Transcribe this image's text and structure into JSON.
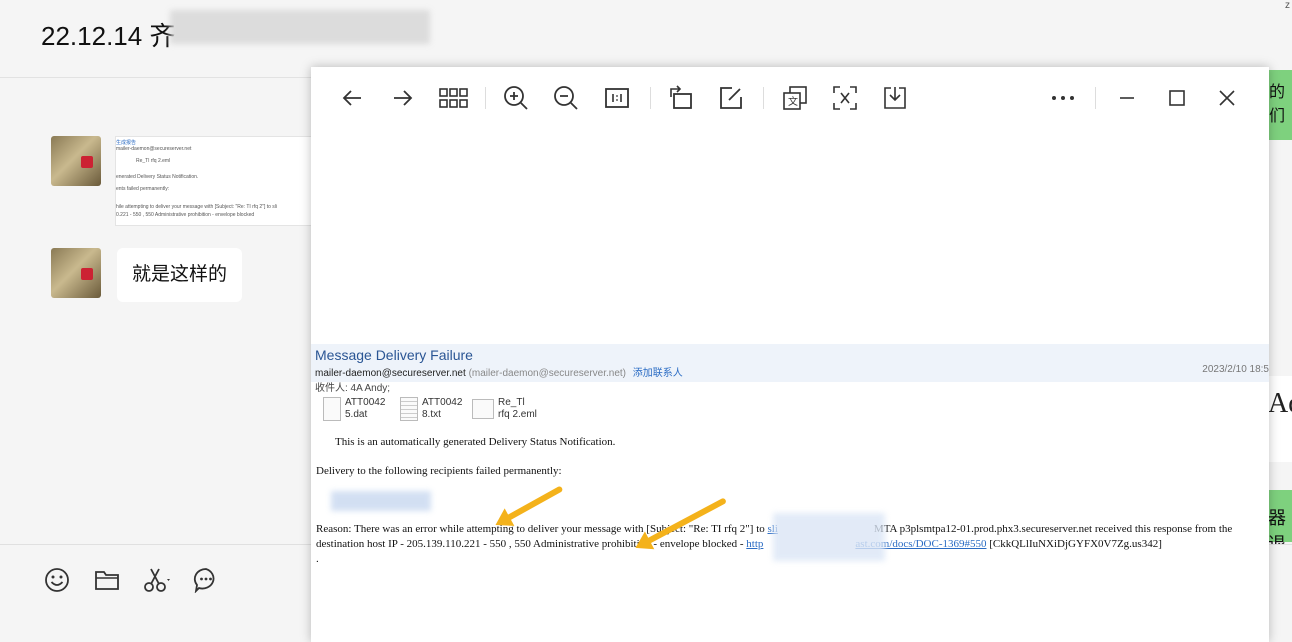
{
  "chat": {
    "title": "22.12.14 齐",
    "message_text": "就是这样的",
    "thumb_lines": [
      "生成报告",
      "mailer-daemon@secureserver.net",
      "Re_Tl rfq 2.eml",
      "enerated Delivery Status Notification.",
      "ents failed permanently:",
      "hile attempting to deliver your message with [Subject: \"Re: TI rfq 2\"] to sli",
      "0.221 - 550 , 550 Administrative prohibition - envelope blocked"
    ],
    "right_edge_texts": [
      "的们",
      "Ad",
      "器退"
    ]
  },
  "compose_icons": [
    "emoji-icon",
    "folder-icon",
    "scissors-icon",
    "chat-bubble-icon"
  ],
  "viewer": {
    "toolbar": [
      "back-icon",
      "forward-icon",
      "grid-icon",
      "zoom-in-icon",
      "zoom-out-icon",
      "actual-size-icon",
      "rotate-icon",
      "edit-icon",
      "translate-icon",
      "ocr-icon",
      "download-icon",
      "more-icon",
      "minimize-icon",
      "maximize-icon",
      "close-icon"
    ],
    "email": {
      "subject": "Message Delivery Failure",
      "from_address": "mailer-daemon@secureserver.net",
      "from_paren": "(mailer-daemon@secureserver.net)",
      "add_contact": "添加联系人",
      "date": "2023/2/10 18:5",
      "to": "收件人: 4A Andy;",
      "attachments": [
        {
          "line1": "ATT0042",
          "line2": "5.dat"
        },
        {
          "line1": "ATT0042",
          "line2": "8.txt"
        },
        {
          "line1": "Re_Tl",
          "line2": "rfq 2.eml"
        }
      ],
      "notice": "This is an automatically generated Delivery Status Notification.",
      "recipients_failed": "Delivery to the following recipients failed permanently:",
      "reason_start": "Reason: There was an error while attempting to deliver your message with [Subject: \"Re: TI rfq 2\"] to ",
      "reason_link": "sli",
      "reason_mid": "MTA p3plsmtpa12-01.prod.phx3.secureserver.net received this response from the",
      "line2_start": "destination host IP - 205.139.110.221 - 550 , 550 Administrative prohibition - envelope blocked - ",
      "line2_link_a": "http",
      "line2_link_b": "ast.com/docs/DOC-1369#550",
      "line2_end": " [CkkQLlIuNXiDjGYFX0V7Zg.us342]",
      "trailing": "."
    }
  }
}
